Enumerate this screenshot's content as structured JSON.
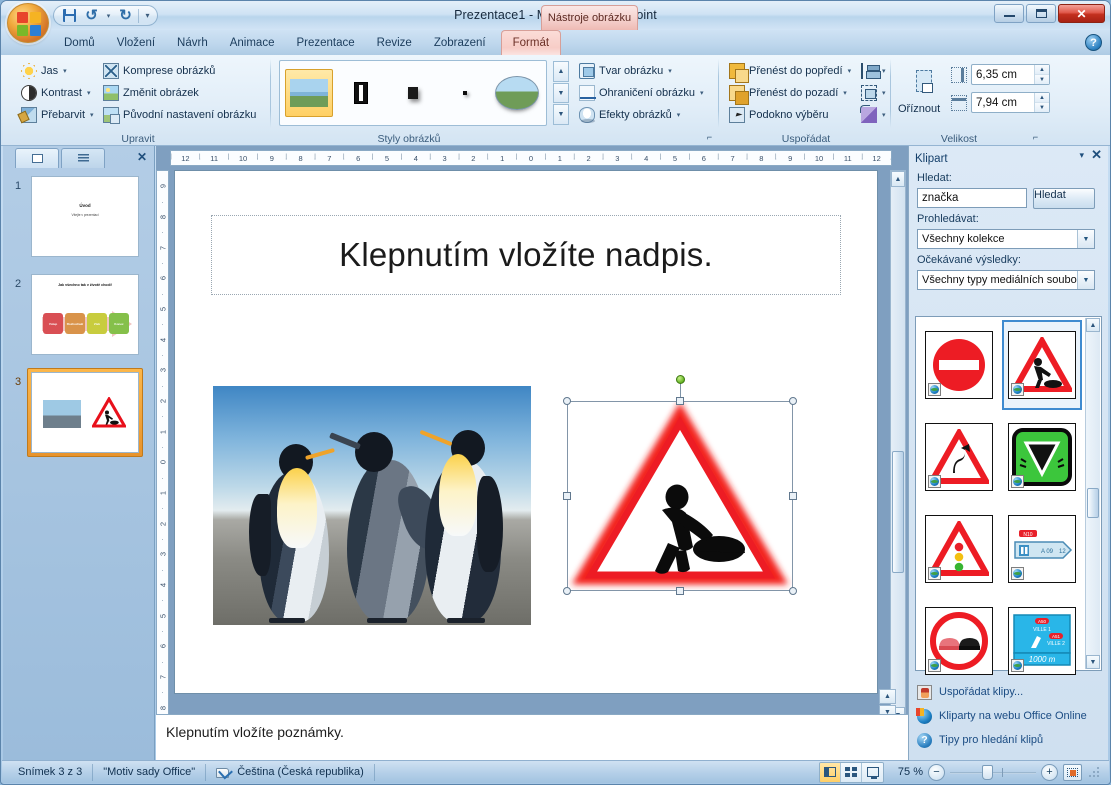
{
  "window": {
    "title": "Prezentace1  -  Microsoft PowerPoint",
    "context_tab_label": "Nástroje obrázku",
    "minimize": "–",
    "maximize": "□",
    "close": "✕",
    "help": "?"
  },
  "quick_access": {
    "save": "save-icon",
    "undo": "↺",
    "redo": "↻",
    "customize": "▾"
  },
  "ribbon": {
    "tabs": [
      {
        "label": "Domů"
      },
      {
        "label": "Vložení"
      },
      {
        "label": "Návrh"
      },
      {
        "label": "Animace"
      },
      {
        "label": "Prezentace"
      },
      {
        "label": "Revize"
      },
      {
        "label": "Zobrazení"
      },
      {
        "label": "Formát"
      }
    ],
    "active_tab": "Formát",
    "groups": [
      {
        "name": "Upravit",
        "label": "Upravit",
        "items": [
          {
            "label": "Jas",
            "arrow": "▾"
          },
          {
            "label": "Kontrast",
            "arrow": "▾"
          },
          {
            "label": "Přebarvit",
            "arrow": "▾"
          },
          {
            "label": "Komprese obrázků",
            "arrow": ""
          },
          {
            "label": "Změnit obrázek",
            "arrow": ""
          },
          {
            "label": "Původní nastavení obrázku",
            "arrow": ""
          }
        ]
      },
      {
        "name": "Styly obrázků",
        "label": "Styly obrázků",
        "dialog_launcher": "⌐"
      },
      {
        "name": "Tvar",
        "items": [
          {
            "label": "Tvar obrázku",
            "arrow": "▾"
          },
          {
            "label": "Ohraničení obrázku",
            "arrow": "▾"
          },
          {
            "label": "Efekty obrázků",
            "arrow": "▾"
          }
        ]
      },
      {
        "name": "Uspořádat",
        "label": "Uspořádat",
        "items": [
          {
            "label": "Přenést do popředí",
            "arrow": "▾"
          },
          {
            "label": "Přenést do pozadí",
            "arrow": "▾"
          },
          {
            "label": "Podokno výběru",
            "arrow": ""
          }
        ],
        "mini_items": [
          {
            "name": "align-icon",
            "arrow": "▾"
          },
          {
            "name": "group-icon",
            "arrow": "▾"
          },
          {
            "name": "rotate-icon",
            "arrow": "▾"
          }
        ]
      },
      {
        "name": "Velikost",
        "label": "Velikost",
        "crop_label": "Oříznout",
        "height_value": "6,35 cm",
        "width_value": "7,94 cm",
        "dialog_launcher": "⌐"
      }
    ]
  },
  "left_pane": {
    "tab_slides": "slides-tab",
    "tab_outline": "outline-tab",
    "close": "✕",
    "slides": [
      {
        "number": "1",
        "title": "Úvod",
        "subtitle": "Vítejte v prezentaci"
      },
      {
        "number": "2",
        "heading": "Jak všechno tak v životě chodí!",
        "boxes": [
          {
            "label": "Vstup",
            "color": "#d94f54"
          },
          {
            "label": "Rozhodnutí",
            "color": "#d9934a"
          },
          {
            "label": "Zisk",
            "color": "#c8cc3e"
          },
          {
            "label": "Konec",
            "color": "#85c04a"
          }
        ]
      },
      {
        "number": "3",
        "active": true
      }
    ]
  },
  "editor": {
    "ruler_h_ticks": [
      "12",
      "11",
      "10",
      "9",
      "8",
      "7",
      "6",
      "5",
      "4",
      "3",
      "2",
      "1",
      "0",
      "1",
      "2",
      "3",
      "4",
      "5",
      "6",
      "7",
      "8",
      "9",
      "10",
      "11",
      "12"
    ],
    "ruler_v_ticks": [
      "9",
      "8",
      "7",
      "6",
      "5",
      "4",
      "3",
      "2",
      "1",
      "0",
      "1",
      "2",
      "3",
      "4",
      "5",
      "6",
      "7",
      "8"
    ],
    "slide": {
      "title_placeholder": "Klepnutím vložíte nadpis.",
      "photo_name": "penguins-photo",
      "sign_name": "roadworks-sign-picture"
    },
    "notes_placeholder": "Klepnutím vložíte poznámky."
  },
  "clipart": {
    "pane_title": "Klipart",
    "dropdown": "▾",
    "close": "✕",
    "search_label": "Hledat:",
    "search_value": "značka",
    "search_button": "Hledat",
    "scope_label": "Prohledávat:",
    "scope_value": "Všechny kolekce",
    "results_label": "Očekávané výsledky:",
    "results_value": "Všechny typy mediálních souborů",
    "thumbnails": [
      {
        "name": "no-entry-sign",
        "selected": false
      },
      {
        "name": "roadworks-sign",
        "selected": true
      },
      {
        "name": "double-bend-sign",
        "selected": false
      },
      {
        "name": "give-way-sign-green",
        "selected": false
      },
      {
        "name": "traffic-signals-sign",
        "selected": false
      },
      {
        "name": "motorway-direction-sign",
        "selected": false
      },
      {
        "name": "no-overtaking-sign",
        "selected": false
      },
      {
        "name": "blue-direction-sign-1000m",
        "selected": false
      }
    ],
    "links": [
      {
        "label": "Uspořádat klipy...",
        "icon": "organize-clips-icon"
      },
      {
        "label": "Kliparty na webu Office Online",
        "icon": "office-online-icon"
      },
      {
        "label": "Tipy pro hledání klipů",
        "icon": "tips-icon"
      }
    ]
  },
  "status_bar": {
    "slide_info": "Snímek 3 z 3",
    "theme": "\"Motiv sady Office\"",
    "language": "Čeština (Česká republika)",
    "spell_icon": "spell-check-icon",
    "views": [
      {
        "name": "normal-view",
        "active": true
      },
      {
        "name": "slide-sorter-view",
        "active": false
      },
      {
        "name": "slideshow-view",
        "active": false
      }
    ],
    "zoom": "75 %",
    "zoom_out": "−",
    "zoom_in": "+",
    "fit_to_window": "fit-slide-icon"
  }
}
